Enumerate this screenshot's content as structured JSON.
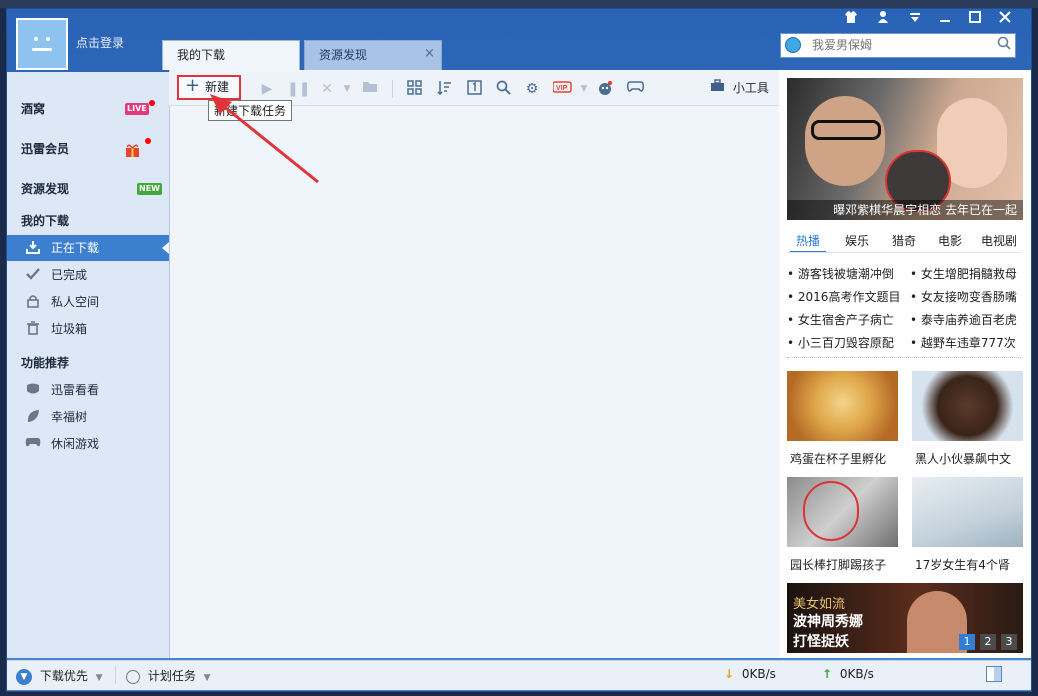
{
  "header": {
    "login_text": "点击登录",
    "tabs": [
      {
        "label": "我的下载",
        "active": true
      },
      {
        "label": "资源发现",
        "active": false
      }
    ],
    "tab_close": "×",
    "window_buttons": [
      "skin-icon",
      "user-icon",
      "menu-icon",
      "minimize-icon",
      "maximize-icon",
      "close-icon"
    ],
    "search_placeholder": "我爱男保姆"
  },
  "sidebar": {
    "items": [
      {
        "label": "酒窝",
        "badge": "LIVE"
      },
      {
        "label": "迅雷会员"
      },
      {
        "label": "资源发现",
        "badge": "NEW"
      }
    ],
    "my_downloads_title": "我的下载",
    "downloads": [
      {
        "label": "正在下载",
        "active": true
      },
      {
        "label": "已完成"
      },
      {
        "label": "私人空间"
      },
      {
        "label": "垃圾箱"
      }
    ],
    "features_title": "功能推荐",
    "features": [
      {
        "label": "迅雷看看"
      },
      {
        "label": "幸福树"
      },
      {
        "label": "休闲游戏"
      }
    ]
  },
  "toolbar": {
    "new_label": "新建",
    "tooltip": "新建下载任务",
    "tools_label": "小工具"
  },
  "right_panel": {
    "hero_caption": "曝邓紫棋华晨宇相恋 去年已在一起",
    "news_tabs": [
      "热播",
      "娱乐",
      "猎奇",
      "电影",
      "电视剧"
    ],
    "news_left": [
      "游客钱被塘潮冲倒",
      "2016高考作文题目",
      "女生宿舍产子病亡",
      "小三百刀毁容原配"
    ],
    "news_right": [
      "女生增肥捐髓救母",
      "女友接吻变香肠嘴",
      "泰寺庙养逾百老虎",
      "越野车违章777次"
    ],
    "thumbs": [
      {
        "caption": "鸡蛋在杯子里孵化"
      },
      {
        "caption": "黑人小伙暴飙中文"
      },
      {
        "caption": "园长棒打脚踢孩子"
      },
      {
        "caption": "17岁女生有4个肾"
      }
    ],
    "banner": {
      "line1": "美女如流",
      "line2": "波神周秀娜",
      "line3": "打怪捉妖"
    },
    "pages": [
      "1",
      "2",
      "3"
    ]
  },
  "status": {
    "priority": "下载优先",
    "schedule": "计划任务",
    "download_speed": "0KB/s",
    "upload_speed": "0KB/s"
  },
  "colors": {
    "accent": "#3d7fcf",
    "highlight_red": "#e0333a"
  }
}
